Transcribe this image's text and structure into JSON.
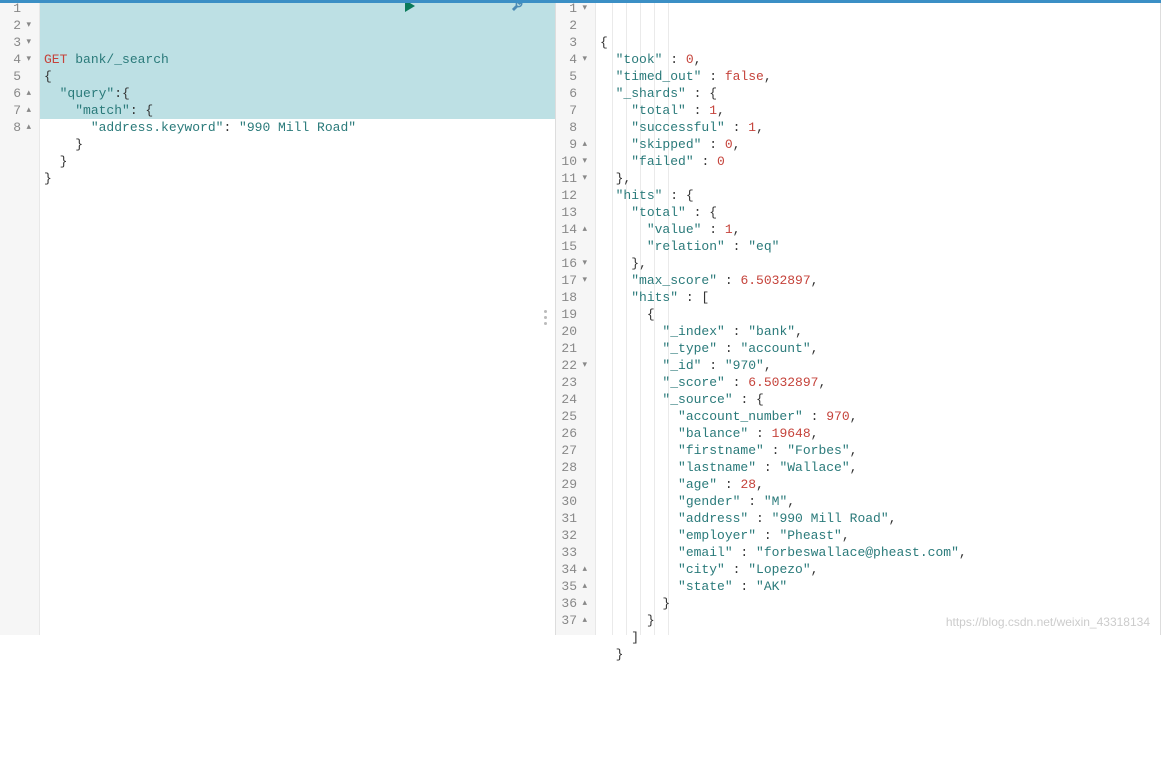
{
  "request": {
    "method": "GET",
    "path": "bank/_search",
    "lines": [
      {
        "n": 1,
        "fold": "",
        "tokens": [
          [
            "method",
            "GET"
          ],
          [
            "plain",
            " "
          ],
          [
            "path",
            "bank/_search"
          ]
        ]
      },
      {
        "n": 2,
        "fold": "▾",
        "tokens": [
          [
            "punc",
            "{"
          ]
        ]
      },
      {
        "n": 3,
        "fold": "▾",
        "tokens": [
          [
            "plain",
            "  "
          ],
          [
            "key",
            "\"query\""
          ],
          [
            "punc",
            ":{"
          ]
        ]
      },
      {
        "n": 4,
        "fold": "▾",
        "tokens": [
          [
            "plain",
            "    "
          ],
          [
            "key",
            "\"match\""
          ],
          [
            "punc",
            ": {"
          ]
        ]
      },
      {
        "n": 5,
        "fold": "",
        "tokens": [
          [
            "plain",
            "      "
          ],
          [
            "key",
            "\"address.keyword\""
          ],
          [
            "punc",
            ": "
          ],
          [
            "string",
            "\"990 Mill Road\""
          ]
        ]
      },
      {
        "n": 6,
        "fold": "▴",
        "tokens": [
          [
            "plain",
            "    "
          ],
          [
            "punc",
            "}"
          ]
        ]
      },
      {
        "n": 7,
        "fold": "▴",
        "tokens": [
          [
            "plain",
            "  "
          ],
          [
            "punc",
            "}"
          ]
        ]
      },
      {
        "n": 8,
        "fold": "▴",
        "tokens": [
          [
            "punc",
            "}"
          ]
        ]
      }
    ],
    "highlight": {
      "from": 1,
      "to": 7
    }
  },
  "response": {
    "lines": [
      {
        "n": 1,
        "fold": "▾",
        "tokens": [
          [
            "punc",
            "{"
          ]
        ]
      },
      {
        "n": 2,
        "fold": "",
        "tokens": [
          [
            "plain",
            "  "
          ],
          [
            "key",
            "\"took\""
          ],
          [
            "punc",
            " : "
          ],
          [
            "num",
            "0"
          ],
          [
            "punc",
            ","
          ]
        ]
      },
      {
        "n": 3,
        "fold": "",
        "tokens": [
          [
            "plain",
            "  "
          ],
          [
            "key",
            "\"timed_out\""
          ],
          [
            "punc",
            " : "
          ],
          [
            "bool",
            "false"
          ],
          [
            "punc",
            ","
          ]
        ]
      },
      {
        "n": 4,
        "fold": "▾",
        "tokens": [
          [
            "plain",
            "  "
          ],
          [
            "key",
            "\"_shards\""
          ],
          [
            "punc",
            " : {"
          ]
        ]
      },
      {
        "n": 5,
        "fold": "",
        "tokens": [
          [
            "plain",
            "    "
          ],
          [
            "key",
            "\"total\""
          ],
          [
            "punc",
            " : "
          ],
          [
            "num",
            "1"
          ],
          [
            "punc",
            ","
          ]
        ]
      },
      {
        "n": 6,
        "fold": "",
        "tokens": [
          [
            "plain",
            "    "
          ],
          [
            "key",
            "\"successful\""
          ],
          [
            "punc",
            " : "
          ],
          [
            "num",
            "1"
          ],
          [
            "punc",
            ","
          ]
        ]
      },
      {
        "n": 7,
        "fold": "",
        "tokens": [
          [
            "plain",
            "    "
          ],
          [
            "key",
            "\"skipped\""
          ],
          [
            "punc",
            " : "
          ],
          [
            "num",
            "0"
          ],
          [
            "punc",
            ","
          ]
        ]
      },
      {
        "n": 8,
        "fold": "",
        "tokens": [
          [
            "plain",
            "    "
          ],
          [
            "key",
            "\"failed\""
          ],
          [
            "punc",
            " : "
          ],
          [
            "num",
            "0"
          ]
        ]
      },
      {
        "n": 9,
        "fold": "▴",
        "tokens": [
          [
            "plain",
            "  "
          ],
          [
            "punc",
            "},"
          ]
        ]
      },
      {
        "n": 10,
        "fold": "▾",
        "tokens": [
          [
            "plain",
            "  "
          ],
          [
            "key",
            "\"hits\""
          ],
          [
            "punc",
            " : {"
          ]
        ]
      },
      {
        "n": 11,
        "fold": "▾",
        "tokens": [
          [
            "plain",
            "    "
          ],
          [
            "key",
            "\"total\""
          ],
          [
            "punc",
            " : {"
          ]
        ]
      },
      {
        "n": 12,
        "fold": "",
        "tokens": [
          [
            "plain",
            "      "
          ],
          [
            "key",
            "\"value\""
          ],
          [
            "punc",
            " : "
          ],
          [
            "num",
            "1"
          ],
          [
            "punc",
            ","
          ]
        ]
      },
      {
        "n": 13,
        "fold": "",
        "tokens": [
          [
            "plain",
            "      "
          ],
          [
            "key",
            "\"relation\""
          ],
          [
            "punc",
            " : "
          ],
          [
            "string",
            "\"eq\""
          ]
        ]
      },
      {
        "n": 14,
        "fold": "▴",
        "tokens": [
          [
            "plain",
            "    "
          ],
          [
            "punc",
            "},"
          ]
        ]
      },
      {
        "n": 15,
        "fold": "",
        "tokens": [
          [
            "plain",
            "    "
          ],
          [
            "key",
            "\"max_score\""
          ],
          [
            "punc",
            " : "
          ],
          [
            "num",
            "6.5032897"
          ],
          [
            "punc",
            ","
          ]
        ]
      },
      {
        "n": 16,
        "fold": "▾",
        "tokens": [
          [
            "plain",
            "    "
          ],
          [
            "key",
            "\"hits\""
          ],
          [
            "punc",
            " : ["
          ]
        ]
      },
      {
        "n": 17,
        "fold": "▾",
        "tokens": [
          [
            "plain",
            "      "
          ],
          [
            "punc",
            "{"
          ]
        ]
      },
      {
        "n": 18,
        "fold": "",
        "tokens": [
          [
            "plain",
            "        "
          ],
          [
            "key",
            "\"_index\""
          ],
          [
            "punc",
            " : "
          ],
          [
            "string",
            "\"bank\""
          ],
          [
            "punc",
            ","
          ]
        ]
      },
      {
        "n": 19,
        "fold": "",
        "tokens": [
          [
            "plain",
            "        "
          ],
          [
            "key",
            "\"_type\""
          ],
          [
            "punc",
            " : "
          ],
          [
            "string",
            "\"account\""
          ],
          [
            "punc",
            ","
          ]
        ]
      },
      {
        "n": 20,
        "fold": "",
        "tokens": [
          [
            "plain",
            "        "
          ],
          [
            "key",
            "\"_id\""
          ],
          [
            "punc",
            " : "
          ],
          [
            "string",
            "\"970\""
          ],
          [
            "punc",
            ","
          ]
        ]
      },
      {
        "n": 21,
        "fold": "",
        "tokens": [
          [
            "plain",
            "        "
          ],
          [
            "key",
            "\"_score\""
          ],
          [
            "punc",
            " : "
          ],
          [
            "num",
            "6.5032897"
          ],
          [
            "punc",
            ","
          ]
        ]
      },
      {
        "n": 22,
        "fold": "▾",
        "tokens": [
          [
            "plain",
            "        "
          ],
          [
            "key",
            "\"_source\""
          ],
          [
            "punc",
            " : {"
          ]
        ]
      },
      {
        "n": 23,
        "fold": "",
        "tokens": [
          [
            "plain",
            "          "
          ],
          [
            "key",
            "\"account_number\""
          ],
          [
            "punc",
            " : "
          ],
          [
            "num",
            "970"
          ],
          [
            "punc",
            ","
          ]
        ]
      },
      {
        "n": 24,
        "fold": "",
        "tokens": [
          [
            "plain",
            "          "
          ],
          [
            "key",
            "\"balance\""
          ],
          [
            "punc",
            " : "
          ],
          [
            "num",
            "19648"
          ],
          [
            "punc",
            ","
          ]
        ]
      },
      {
        "n": 25,
        "fold": "",
        "tokens": [
          [
            "plain",
            "          "
          ],
          [
            "key",
            "\"firstname\""
          ],
          [
            "punc",
            " : "
          ],
          [
            "string",
            "\"Forbes\""
          ],
          [
            "punc",
            ","
          ]
        ]
      },
      {
        "n": 26,
        "fold": "",
        "tokens": [
          [
            "plain",
            "          "
          ],
          [
            "key",
            "\"lastname\""
          ],
          [
            "punc",
            " : "
          ],
          [
            "string",
            "\"Wallace\""
          ],
          [
            "punc",
            ","
          ]
        ]
      },
      {
        "n": 27,
        "fold": "",
        "tokens": [
          [
            "plain",
            "          "
          ],
          [
            "key",
            "\"age\""
          ],
          [
            "punc",
            " : "
          ],
          [
            "num",
            "28"
          ],
          [
            "punc",
            ","
          ]
        ]
      },
      {
        "n": 28,
        "fold": "",
        "tokens": [
          [
            "plain",
            "          "
          ],
          [
            "key",
            "\"gender\""
          ],
          [
            "punc",
            " : "
          ],
          [
            "string",
            "\"M\""
          ],
          [
            "punc",
            ","
          ]
        ]
      },
      {
        "n": 29,
        "fold": "",
        "tokens": [
          [
            "plain",
            "          "
          ],
          [
            "key",
            "\"address\""
          ],
          [
            "punc",
            " : "
          ],
          [
            "string",
            "\"990 Mill Road\""
          ],
          [
            "punc",
            ","
          ]
        ]
      },
      {
        "n": 30,
        "fold": "",
        "tokens": [
          [
            "plain",
            "          "
          ],
          [
            "key",
            "\"employer\""
          ],
          [
            "punc",
            " : "
          ],
          [
            "string",
            "\"Pheast\""
          ],
          [
            "punc",
            ","
          ]
        ]
      },
      {
        "n": 31,
        "fold": "",
        "tokens": [
          [
            "plain",
            "          "
          ],
          [
            "key",
            "\"email\""
          ],
          [
            "punc",
            " : "
          ],
          [
            "string",
            "\"forbeswallace@pheast.com\""
          ],
          [
            "punc",
            ","
          ]
        ]
      },
      {
        "n": 32,
        "fold": "",
        "tokens": [
          [
            "plain",
            "          "
          ],
          [
            "key",
            "\"city\""
          ],
          [
            "punc",
            " : "
          ],
          [
            "string",
            "\"Lopezo\""
          ],
          [
            "punc",
            ","
          ]
        ]
      },
      {
        "n": 33,
        "fold": "",
        "tokens": [
          [
            "plain",
            "          "
          ],
          [
            "key",
            "\"state\""
          ],
          [
            "punc",
            " : "
          ],
          [
            "string",
            "\"AK\""
          ]
        ]
      },
      {
        "n": 34,
        "fold": "▴",
        "tokens": [
          [
            "plain",
            "        "
          ],
          [
            "punc",
            "}"
          ]
        ]
      },
      {
        "n": 35,
        "fold": "▴",
        "tokens": [
          [
            "plain",
            "      "
          ],
          [
            "punc",
            "}"
          ]
        ]
      },
      {
        "n": 36,
        "fold": "▴",
        "tokens": [
          [
            "plain",
            "    "
          ],
          [
            "punc",
            "]"
          ]
        ]
      },
      {
        "n": 37,
        "fold": "▴",
        "tokens": [
          [
            "plain",
            "  "
          ],
          [
            "punc",
            "}"
          ]
        ]
      }
    ]
  },
  "actions": {
    "run_title": "Click to send request",
    "wrench_title": "Open documentation / Auto indent"
  },
  "watermark": "https://blog.csdn.net/weixin_43318134"
}
